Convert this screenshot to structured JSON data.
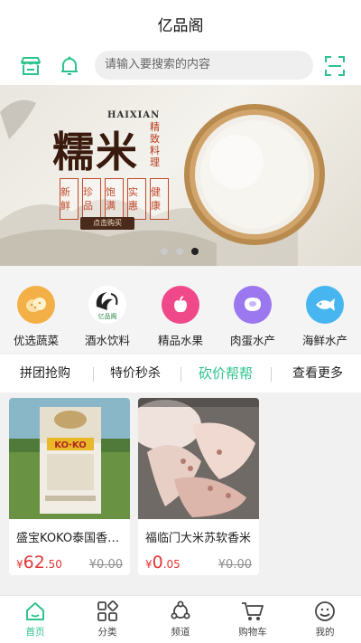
{
  "app": {
    "title": "亿品阁"
  },
  "search": {
    "placeholder": "请输入要搜索的内容"
  },
  "banner": {
    "haixian": "HAIXIAN",
    "title": "糯米",
    "vertical_text": "精致料理",
    "badges": [
      "新鲜",
      "珍品",
      "饱满",
      "实惠",
      "健康"
    ],
    "button_label": "点击购买",
    "dots": 3,
    "active_dot": 3
  },
  "categories": [
    {
      "label": "优选蔬菜",
      "icon": "vegetable-icon",
      "color": "#f3b047"
    },
    {
      "label": "酒水饮料",
      "icon": "yipinge-logo",
      "color": "#ffffff"
    },
    {
      "label": "精品水果",
      "icon": "apple-icon",
      "color": "#f0498a"
    },
    {
      "label": "肉蛋水产",
      "icon": "meat-icon",
      "color": "#9b77f0"
    },
    {
      "label": "海鲜水产",
      "icon": "fish-icon",
      "color": "#47b6f0"
    }
  ],
  "tabs": [
    {
      "label": "拼团抢购",
      "active": false
    },
    {
      "label": "特价秒杀",
      "active": false
    },
    {
      "label": "砍价帮帮",
      "active": true
    },
    {
      "label": "查看更多",
      "active": false
    }
  ],
  "products": [
    {
      "name": "盛宝KOKO泰国香米5kg",
      "price_symbol": "¥",
      "price_int": "62",
      "price_dec": ".50",
      "old_price": "¥0.00"
    },
    {
      "name": "福临门大米苏软香米",
      "price_symbol": "¥",
      "price_int": "0",
      "price_dec": ".05",
      "old_price": "¥0.00"
    }
  ],
  "tabbar": [
    {
      "label": "首页",
      "icon": "home-icon",
      "active": true
    },
    {
      "label": "分类",
      "icon": "category-icon",
      "active": false
    },
    {
      "label": "频道",
      "icon": "channel-icon",
      "active": false
    },
    {
      "label": "购物车",
      "icon": "cart-icon",
      "active": false
    },
    {
      "label": "我的",
      "icon": "user-icon",
      "active": false
    }
  ],
  "colors": {
    "accent": "#2ec38c",
    "price": "#e23636"
  }
}
